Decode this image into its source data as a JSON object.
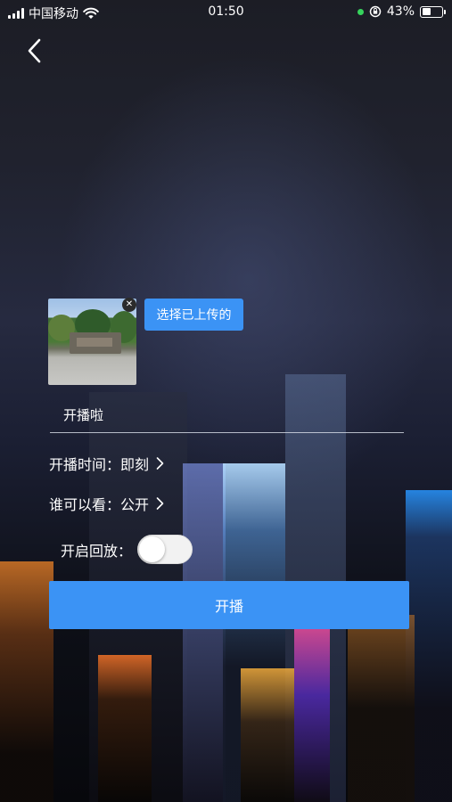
{
  "status_bar": {
    "carrier": "中国移动",
    "time": "01:50",
    "battery": "43%",
    "battery_level": 0.43
  },
  "cover": {
    "choose_label": "选择已上传的",
    "remove_icon": "close-icon"
  },
  "title_field": {
    "value": "开播啦"
  },
  "options": {
    "start_time": "开播时间：即刻",
    "audience": "谁可以看：公开",
    "replay_label": "开启回放：",
    "replay_on": false
  },
  "start_button": {
    "label": "开播"
  },
  "colors": {
    "accent": "#3b93f5"
  }
}
